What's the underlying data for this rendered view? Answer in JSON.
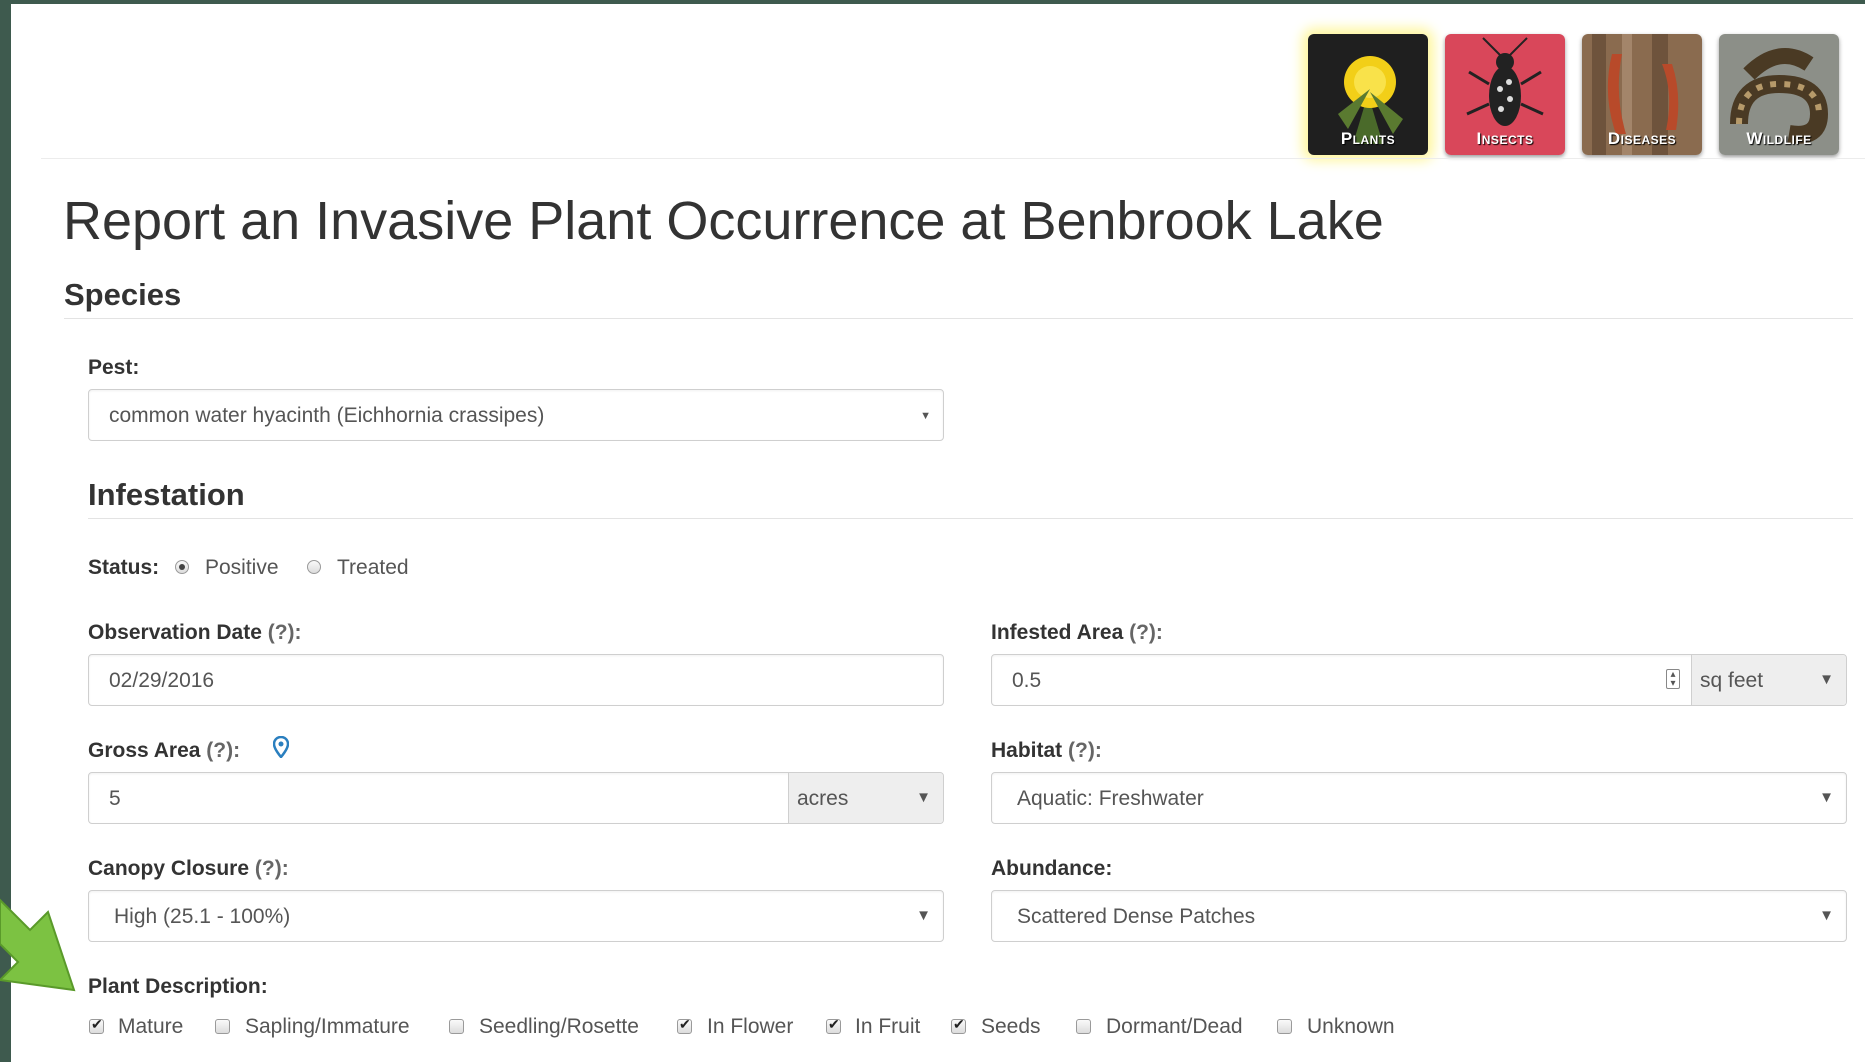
{
  "categories": [
    {
      "label": "Plants",
      "active": true
    },
    {
      "label": "Insects",
      "active": false
    },
    {
      "label": "Diseases",
      "active": false
    },
    {
      "label": "Wildlife",
      "active": false
    }
  ],
  "title": "Report an Invasive Plant Occurrence at Benbrook Lake",
  "species": {
    "heading": "Species",
    "pest_label": "Pest:",
    "pest_value": "common water hyacinth (Eichhornia crassipes)"
  },
  "infestation": {
    "heading": "Infestation",
    "status_label": "Status:",
    "status_options": [
      "Positive",
      "Treated"
    ],
    "status_selected": "Positive",
    "observation_date": {
      "label": "Observation Date",
      "help": "(?):",
      "value": "02/29/2016"
    },
    "infested_area": {
      "label": "Infested Area",
      "help": "(?):",
      "value": "0.5",
      "unit": "sq feet"
    },
    "gross_area": {
      "label": "Gross Area",
      "help": "(?):",
      "value": "5",
      "unit": "acres"
    },
    "habitat": {
      "label": "Habitat",
      "help": "(?):",
      "value": "Aquatic: Freshwater"
    },
    "canopy_closure": {
      "label": "Canopy Closure",
      "help": "(?):",
      "value": "High (25.1 - 100%)"
    },
    "abundance": {
      "label": "Abundance:",
      "value": "Scattered Dense Patches"
    },
    "plant_description": {
      "label": "Plant Description:",
      "options": [
        {
          "label": "Mature",
          "checked": true
        },
        {
          "label": "Sapling/Immature",
          "checked": false
        },
        {
          "label": "Seedling/Rosette",
          "checked": false
        },
        {
          "label": "In Flower",
          "checked": true
        },
        {
          "label": "In Fruit",
          "checked": true
        },
        {
          "label": "Seeds",
          "checked": true
        },
        {
          "label": "Dormant/Dead",
          "checked": false
        },
        {
          "label": "Unknown",
          "checked": false
        }
      ]
    }
  },
  "colors": {
    "pin": "#2a7fbf",
    "arrow": "#7cc242",
    "plants_bg": "#1f1f1f",
    "insects_bg": "#d9475a",
    "diseases_bg": "#8a6b4f",
    "wildlife_bg": "#8c8f88"
  }
}
